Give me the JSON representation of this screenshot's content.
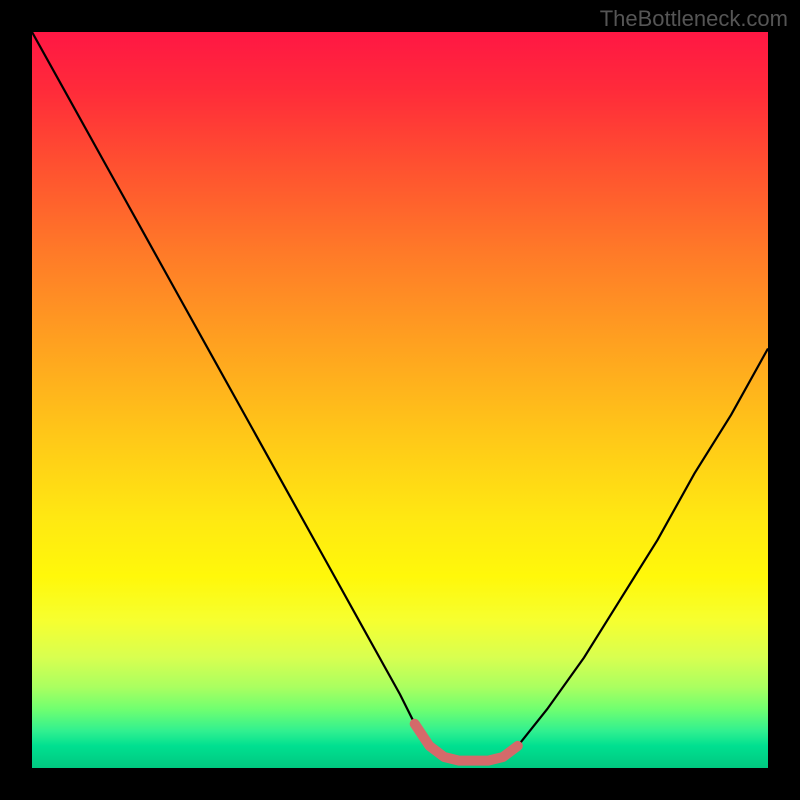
{
  "watermark": "TheBottleneck.com",
  "chart_data": {
    "type": "line",
    "title": "",
    "xlabel": "",
    "ylabel": "",
    "xlim": [
      0,
      100
    ],
    "ylim": [
      0,
      100
    ],
    "series": [
      {
        "name": "bottleneck-curve",
        "x": [
          0,
          5,
          10,
          15,
          20,
          25,
          30,
          35,
          40,
          45,
          50,
          52,
          54,
          56,
          58,
          60,
          62,
          64,
          66,
          70,
          75,
          80,
          85,
          90,
          95,
          100
        ],
        "values": [
          100,
          91,
          82,
          73,
          64,
          55,
          46,
          37,
          28,
          19,
          10,
          6,
          3,
          1.5,
          1,
          1,
          1,
          1.5,
          3,
          8,
          15,
          23,
          31,
          40,
          48,
          57
        ]
      },
      {
        "name": "optimal-segment",
        "x": [
          52,
          54,
          56,
          58,
          60,
          62,
          64,
          66
        ],
        "values": [
          6,
          3,
          1.5,
          1,
          1,
          1,
          1.5,
          3
        ]
      }
    ],
    "gradient_stops": [
      {
        "pct": 0,
        "color": "#ff1744"
      },
      {
        "pct": 30,
        "color": "#ff7a28"
      },
      {
        "pct": 66,
        "color": "#ffe812"
      },
      {
        "pct": 85,
        "color": "#d8ff50"
      },
      {
        "pct": 100,
        "color": "#00c880"
      }
    ]
  }
}
